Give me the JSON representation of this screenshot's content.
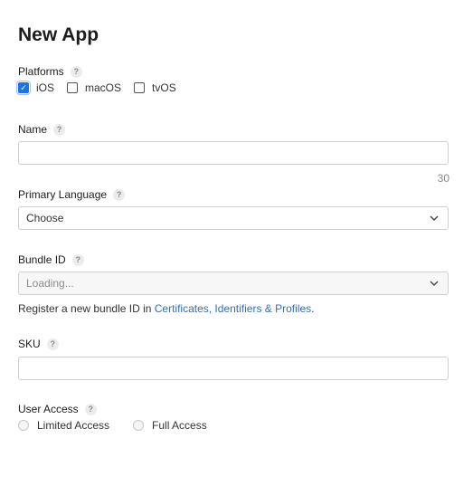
{
  "page": {
    "title": "New App"
  },
  "platforms": {
    "label": "Platforms",
    "options": [
      {
        "label": "iOS",
        "checked": true
      },
      {
        "label": "macOS",
        "checked": false
      },
      {
        "label": "tvOS",
        "checked": false
      }
    ]
  },
  "name": {
    "label": "Name",
    "value": "",
    "char_count": "30"
  },
  "primary_language": {
    "label": "Primary Language",
    "selected": "Choose"
  },
  "bundle_id": {
    "label": "Bundle ID",
    "selected": "Loading...",
    "register_text": "Register a new bundle ID in ",
    "register_link": "Certificates, Identifiers & Profiles",
    "register_suffix": "."
  },
  "sku": {
    "label": "SKU",
    "value": ""
  },
  "user_access": {
    "label": "User Access",
    "options": [
      {
        "label": "Limited Access"
      },
      {
        "label": "Full Access"
      }
    ]
  },
  "help_glyph": "?"
}
